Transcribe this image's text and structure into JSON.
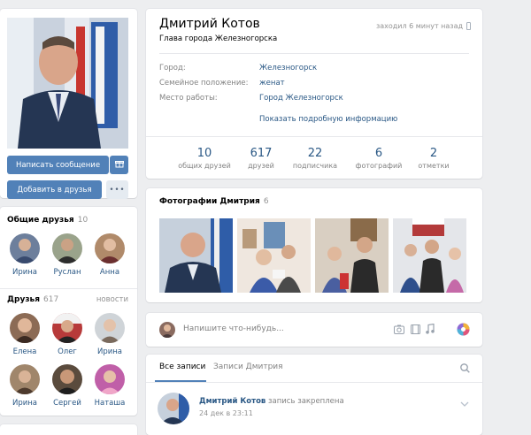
{
  "profile": {
    "name": "Дмитрий Котов",
    "status": "Глава города Железногорска",
    "last_seen": "заходил 6 минут назад",
    "fields": [
      {
        "label": "Город:",
        "value": "Железногорск"
      },
      {
        "label": "Семейное положение:",
        "value": "женат"
      },
      {
        "label": "Место работы:",
        "value": "Город Железногорск"
      }
    ],
    "more_info": "Показать подробную информацию"
  },
  "actions": {
    "message": "Написать сообщение",
    "add_friend": "Добавить в друзья",
    "more": "•••"
  },
  "counters": [
    {
      "num": "10",
      "label": "общих друзей"
    },
    {
      "num": "617",
      "label": "друзей"
    },
    {
      "num": "22",
      "label": "подписчика"
    },
    {
      "num": "6",
      "label": "фотографий"
    },
    {
      "num": "2",
      "label": "отметки"
    }
  ],
  "common_friends": {
    "title": "Общие друзья",
    "count": "10",
    "items": [
      {
        "name": "Ирина"
      },
      {
        "name": "Руслан"
      },
      {
        "name": "Анна"
      }
    ]
  },
  "friends": {
    "title": "Друзья",
    "count": "617",
    "news": "новости",
    "items": [
      {
        "name": "Елена"
      },
      {
        "name": "Олег"
      },
      {
        "name": "Ирина"
      },
      {
        "name": "Ирина"
      },
      {
        "name": "Сергей"
      },
      {
        "name": "Наташа"
      }
    ]
  },
  "photos": {
    "title": "Фотографии Дмитрия",
    "count": "6"
  },
  "post_form": {
    "placeholder": "Напишите что-нибудь..."
  },
  "wall": {
    "tab_all": "Все записи",
    "tab_own": "Записи Дмитрия",
    "post": {
      "author": "Дмитрий Котов",
      "note": "запись закреплена",
      "date": "24 дек в 23:11"
    }
  },
  "colors": {
    "accent": "#5181b8",
    "link": "#2a5885",
    "bg": "#edeef0"
  }
}
